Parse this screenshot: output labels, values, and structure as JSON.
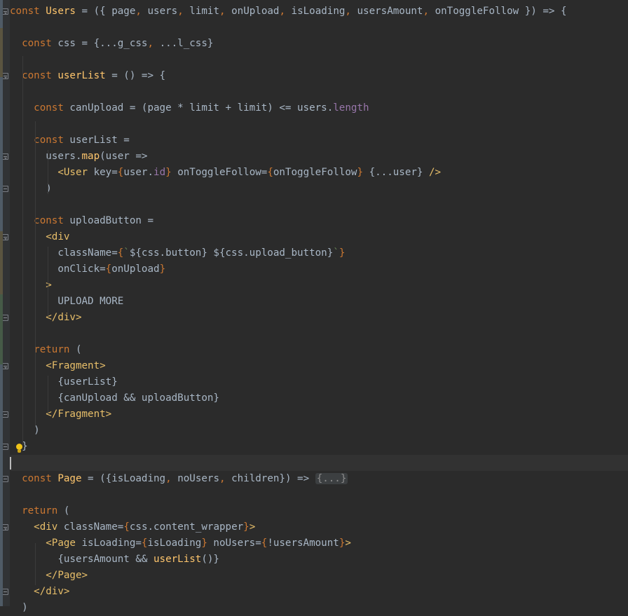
{
  "editor": {
    "lines": [
      {
        "segments": [
          [
            "kw",
            "const "
          ],
          [
            "fn",
            "Users"
          ],
          [
            "def",
            " = ({ page"
          ],
          [
            "kw",
            ", "
          ],
          [
            "def",
            "users"
          ],
          [
            "kw",
            ", "
          ],
          [
            "def",
            "limit"
          ],
          [
            "kw",
            ", "
          ],
          [
            "def",
            "onUpload"
          ],
          [
            "kw",
            ", "
          ],
          [
            "def",
            "isLoading"
          ],
          [
            "kw",
            ", "
          ],
          [
            "def",
            "usersAmount"
          ],
          [
            "kw",
            ", "
          ],
          [
            "def",
            "onToggleFollow }) => {"
          ]
        ]
      },
      {
        "segments": []
      },
      {
        "segments": [
          [
            "def",
            "  "
          ],
          [
            "kw",
            "const "
          ],
          [
            "def",
            "css = {...g_css"
          ],
          [
            "kw",
            ", "
          ],
          [
            "def",
            "...l_css}"
          ]
        ]
      },
      {
        "segments": []
      },
      {
        "segments": [
          [
            "def",
            "  "
          ],
          [
            "kw",
            "const "
          ],
          [
            "fn",
            "userList"
          ],
          [
            "def",
            " = () => {"
          ]
        ]
      },
      {
        "segments": []
      },
      {
        "segments": [
          [
            "def",
            "    "
          ],
          [
            "kw",
            "const "
          ],
          [
            "def",
            "canUpload = (page * limit + limit) <= users."
          ],
          [
            "prop",
            "length"
          ]
        ]
      },
      {
        "segments": []
      },
      {
        "segments": [
          [
            "def",
            "    "
          ],
          [
            "kw",
            "const "
          ],
          [
            "def",
            "userList ="
          ]
        ]
      },
      {
        "segments": [
          [
            "def",
            "      users."
          ],
          [
            "fn",
            "map"
          ],
          [
            "def",
            "(user =>"
          ]
        ]
      },
      {
        "segments": [
          [
            "def",
            "        "
          ],
          [
            "tag",
            "<User "
          ],
          [
            "def",
            "key="
          ],
          [
            "kw",
            "{"
          ],
          [
            "def",
            "user."
          ],
          [
            "prop",
            "id"
          ],
          [
            "kw",
            "}"
          ],
          [
            "def",
            " onToggleFollow="
          ],
          [
            "kw",
            "{"
          ],
          [
            "def",
            "onToggleFollow"
          ],
          [
            "kw",
            "}"
          ],
          [
            "def",
            " {...user} "
          ],
          [
            "tag",
            "/>"
          ]
        ]
      },
      {
        "segments": [
          [
            "def",
            "      )"
          ]
        ]
      },
      {
        "segments": []
      },
      {
        "segments": [
          [
            "def",
            "    "
          ],
          [
            "kw",
            "const "
          ],
          [
            "def",
            "uploadButton ="
          ]
        ]
      },
      {
        "segments": [
          [
            "def",
            "      "
          ],
          [
            "tag",
            "<div"
          ]
        ]
      },
      {
        "segments": [
          [
            "def",
            "        className="
          ],
          [
            "kw",
            "{"
          ],
          [
            "str",
            "`"
          ],
          [
            "def",
            "${css.button} ${css.upload_button}"
          ],
          [
            "str",
            "`"
          ],
          [
            "kw",
            "}"
          ]
        ]
      },
      {
        "segments": [
          [
            "def",
            "        onClick="
          ],
          [
            "kw",
            "{"
          ],
          [
            "def",
            "onUpload"
          ],
          [
            "kw",
            "}"
          ]
        ]
      },
      {
        "segments": [
          [
            "def",
            "      "
          ],
          [
            "tag",
            ">"
          ]
        ]
      },
      {
        "segments": [
          [
            "def",
            "        UPLOAD MORE"
          ]
        ]
      },
      {
        "segments": [
          [
            "def",
            "      "
          ],
          [
            "tag",
            "</div>"
          ]
        ]
      },
      {
        "segments": []
      },
      {
        "segments": [
          [
            "def",
            "    "
          ],
          [
            "kw",
            "return "
          ],
          [
            "def",
            "("
          ]
        ]
      },
      {
        "segments": [
          [
            "def",
            "      "
          ],
          [
            "tag",
            "<Fragment>"
          ]
        ]
      },
      {
        "segments": [
          [
            "def",
            "        {userList}"
          ]
        ]
      },
      {
        "segments": [
          [
            "def",
            "        {canUpload && uploadButton}"
          ]
        ]
      },
      {
        "segments": [
          [
            "def",
            "      "
          ],
          [
            "tag",
            "</Fragment>"
          ]
        ]
      },
      {
        "segments": [
          [
            "def",
            "    )"
          ]
        ]
      },
      {
        "segments": [
          [
            "def",
            "  }"
          ]
        ]
      },
      {
        "segments": []
      },
      {
        "segments": [
          [
            "def",
            "  "
          ],
          [
            "kw",
            "const "
          ],
          [
            "fn",
            "Page"
          ],
          [
            "def",
            " = ({isLoading"
          ],
          [
            "kw",
            ", "
          ],
          [
            "def",
            "noUsers"
          ],
          [
            "kw",
            ", "
          ],
          [
            "def",
            "children}) => "
          ],
          [
            "folded",
            "{...}"
          ]
        ]
      },
      {
        "segments": []
      },
      {
        "segments": [
          [
            "def",
            "  "
          ],
          [
            "kw",
            "return "
          ],
          [
            "def",
            "("
          ]
        ]
      },
      {
        "segments": [
          [
            "def",
            "    "
          ],
          [
            "tag",
            "<div "
          ],
          [
            "def",
            "className="
          ],
          [
            "kw",
            "{"
          ],
          [
            "def",
            "css.content_wrapper"
          ],
          [
            "kw",
            "}"
          ],
          [
            "tag",
            ">"
          ]
        ]
      },
      {
        "segments": [
          [
            "def",
            "      "
          ],
          [
            "tag",
            "<Page "
          ],
          [
            "def",
            "isLoading="
          ],
          [
            "kw",
            "{"
          ],
          [
            "def",
            "isLoading"
          ],
          [
            "kw",
            "}"
          ],
          [
            "def",
            " noUsers="
          ],
          [
            "kw",
            "{"
          ],
          [
            "def",
            "!usersAmount"
          ],
          [
            "kw",
            "}"
          ],
          [
            "tag",
            ">"
          ]
        ]
      },
      {
        "segments": [
          [
            "def",
            "        {usersAmount && "
          ],
          [
            "fn",
            "userList"
          ],
          [
            "def",
            "()}"
          ]
        ]
      },
      {
        "segments": [
          [
            "def",
            "      "
          ],
          [
            "tag",
            "</Page>"
          ]
        ]
      },
      {
        "segments": [
          [
            "def",
            "    "
          ],
          [
            "tag",
            "</div>"
          ]
        ]
      },
      {
        "segments": [
          [
            "def",
            "  )"
          ]
        ]
      }
    ],
    "current_line_index": 28
  },
  "colors": {
    "background": "#2b2b2b",
    "gutter": "#313335",
    "keyword": "#cc7832",
    "function": "#ffc66d",
    "tag": "#e8bf6a",
    "property": "#9876aa",
    "text": "#a9b7c6"
  },
  "icons": [
    "fold-marker-icon",
    "lightbulb-icon",
    "text-caret"
  ]
}
